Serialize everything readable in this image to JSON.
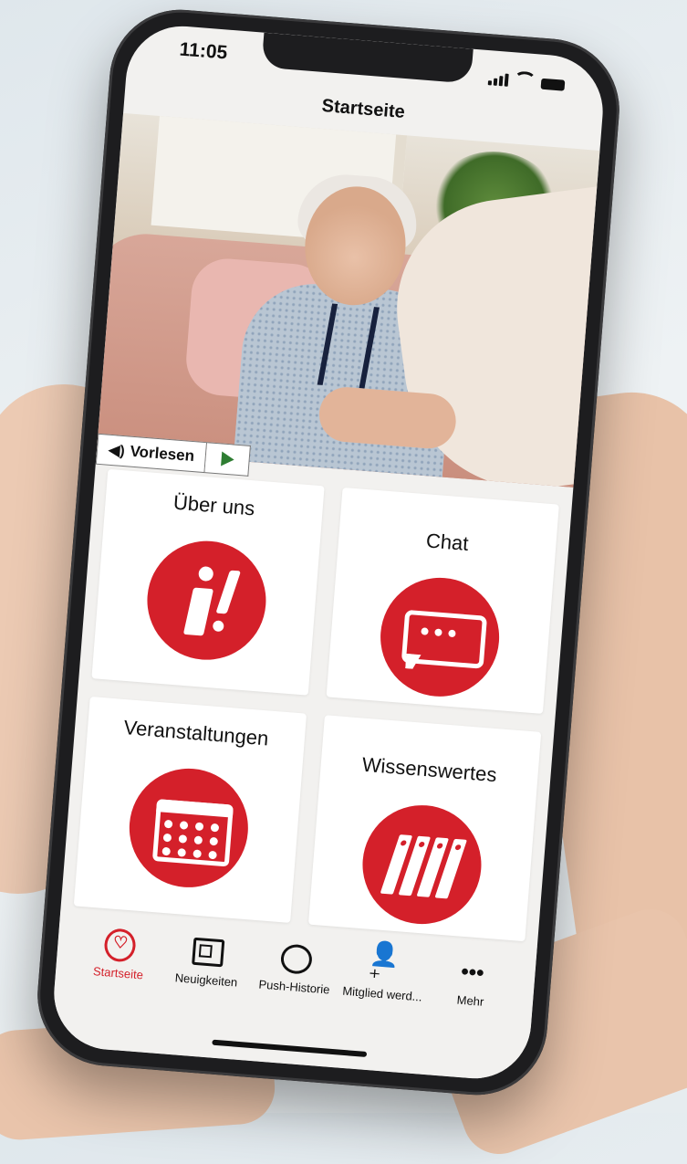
{
  "status": {
    "time": "11:05"
  },
  "nav": {
    "title": "Startseite"
  },
  "readaloud": {
    "label": "Vorlesen"
  },
  "tiles": [
    {
      "label": "Über uns",
      "icon": "info-exclamation-icon"
    },
    {
      "label": "Chat",
      "icon": "chat-bubble-icon"
    },
    {
      "label": "Veranstaltungen",
      "icon": "calendar-icon"
    },
    {
      "label": "Wissenswertes",
      "icon": "books-icon"
    }
  ],
  "tabbar": {
    "items": [
      {
        "label": "Startseite",
        "icon": "heart-icon",
        "active": true
      },
      {
        "label": "Neuigkeiten",
        "icon": "newspaper-icon"
      },
      {
        "label": "Push-Historie",
        "icon": "chat-icon"
      },
      {
        "label": "Mitglied werd...",
        "icon": "add-person-icon"
      },
      {
        "label": "Mehr",
        "icon": "more-icon"
      }
    ]
  },
  "colors": {
    "accent": "#d4202a",
    "screen_bg": "#f2f1ef"
  }
}
